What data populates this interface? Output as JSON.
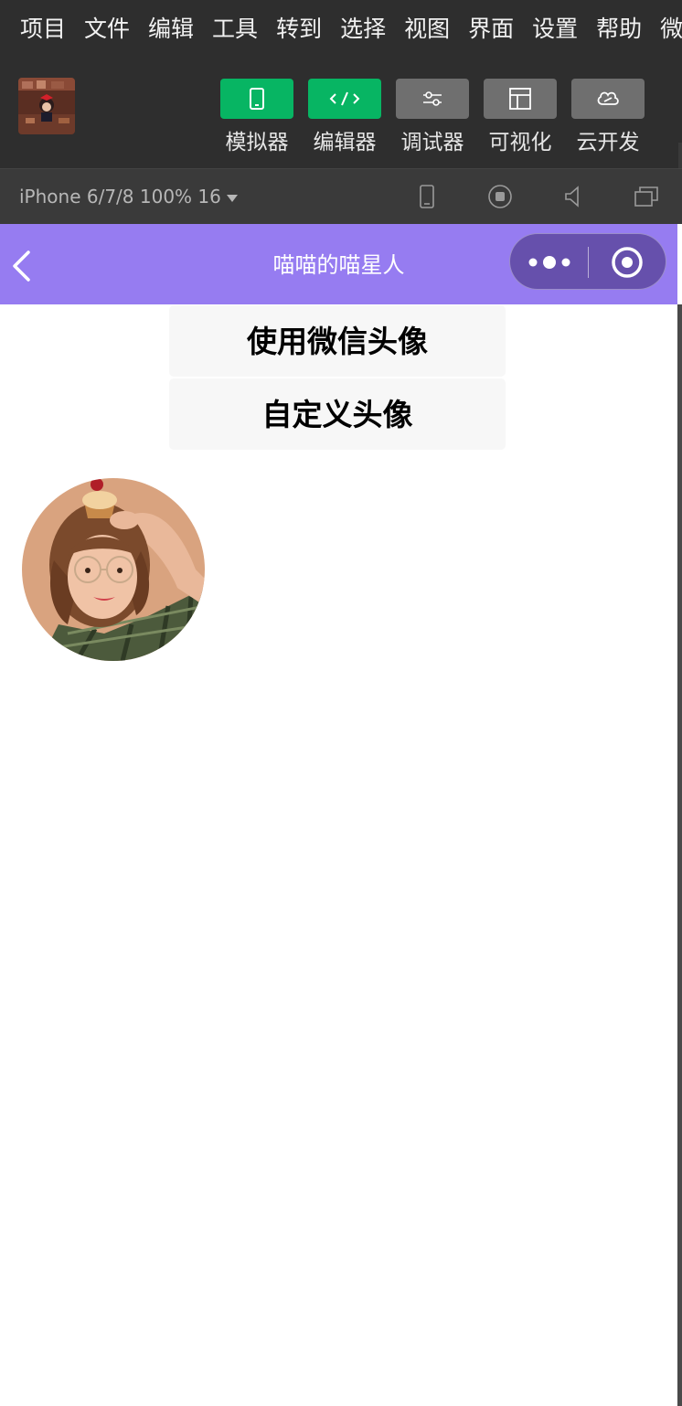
{
  "menubar": {
    "items": [
      "项目",
      "文件",
      "编辑",
      "工具",
      "转到",
      "选择",
      "视图",
      "界面",
      "设置",
      "帮助",
      "微"
    ]
  },
  "toolbar": {
    "tools": [
      {
        "label": "模拟器",
        "icon": "phone-icon",
        "active": true
      },
      {
        "label": "编辑器",
        "icon": "code-icon",
        "active": true
      },
      {
        "label": "调试器",
        "icon": "sliders-icon",
        "active": false
      },
      {
        "label": "可视化",
        "icon": "layout-icon",
        "active": false
      },
      {
        "label": "云开发",
        "icon": "cloud-icon",
        "active": false
      }
    ]
  },
  "devicebar": {
    "device": "iPhone 6/7/8 100% 16"
  },
  "navbar": {
    "title": "喵喵的喵星人"
  },
  "page": {
    "button_wechat_avatar": "使用微信头像",
    "button_custom_avatar": "自定义头像"
  },
  "colors": {
    "navbar": "#967cf1",
    "capsule": "#6650ac",
    "active_tool": "#07b563",
    "inactive_tool": "#6f6f6f"
  }
}
